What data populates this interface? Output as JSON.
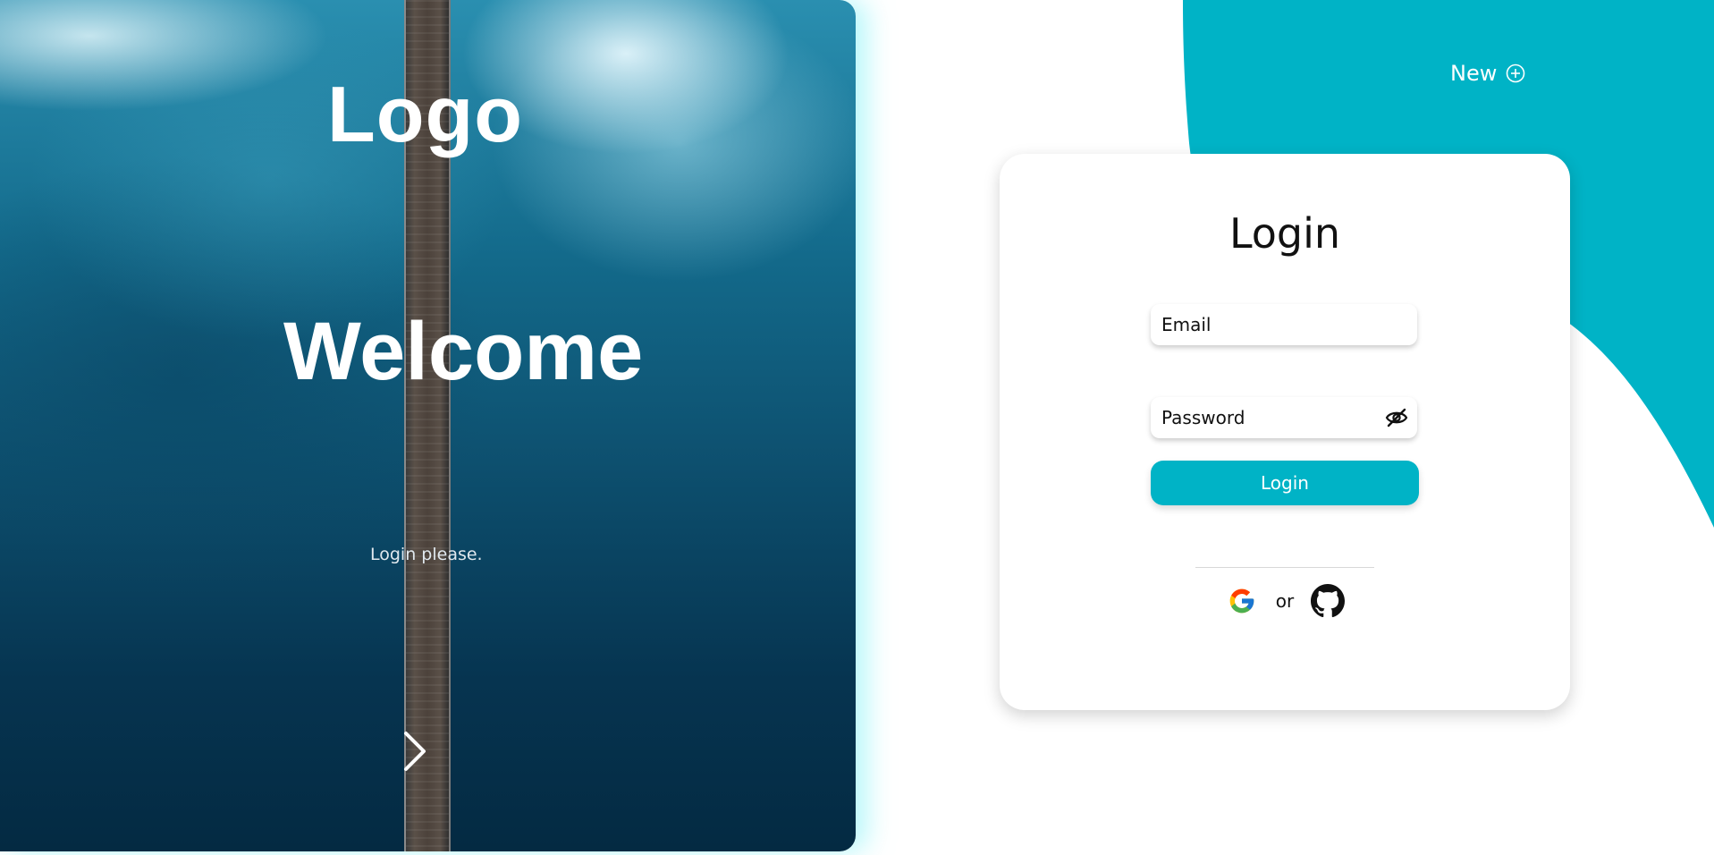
{
  "hero": {
    "logo": "Logo",
    "welcome": "Welcome",
    "subtitle": "Login please."
  },
  "header": {
    "new_label": "New"
  },
  "login_form": {
    "title": "Login",
    "email_placeholder": "Email",
    "password_placeholder": "Password",
    "submit_label": "Login",
    "separator_text": "or"
  },
  "icons": {
    "next": "chevron-right-icon",
    "new": "plus-circle-icon",
    "password_toggle": "eye-off-icon",
    "google": "google-icon",
    "github": "github-icon"
  },
  "colors": {
    "accent": "#00b3c6",
    "text": "#111111",
    "background": "#ffffff"
  }
}
